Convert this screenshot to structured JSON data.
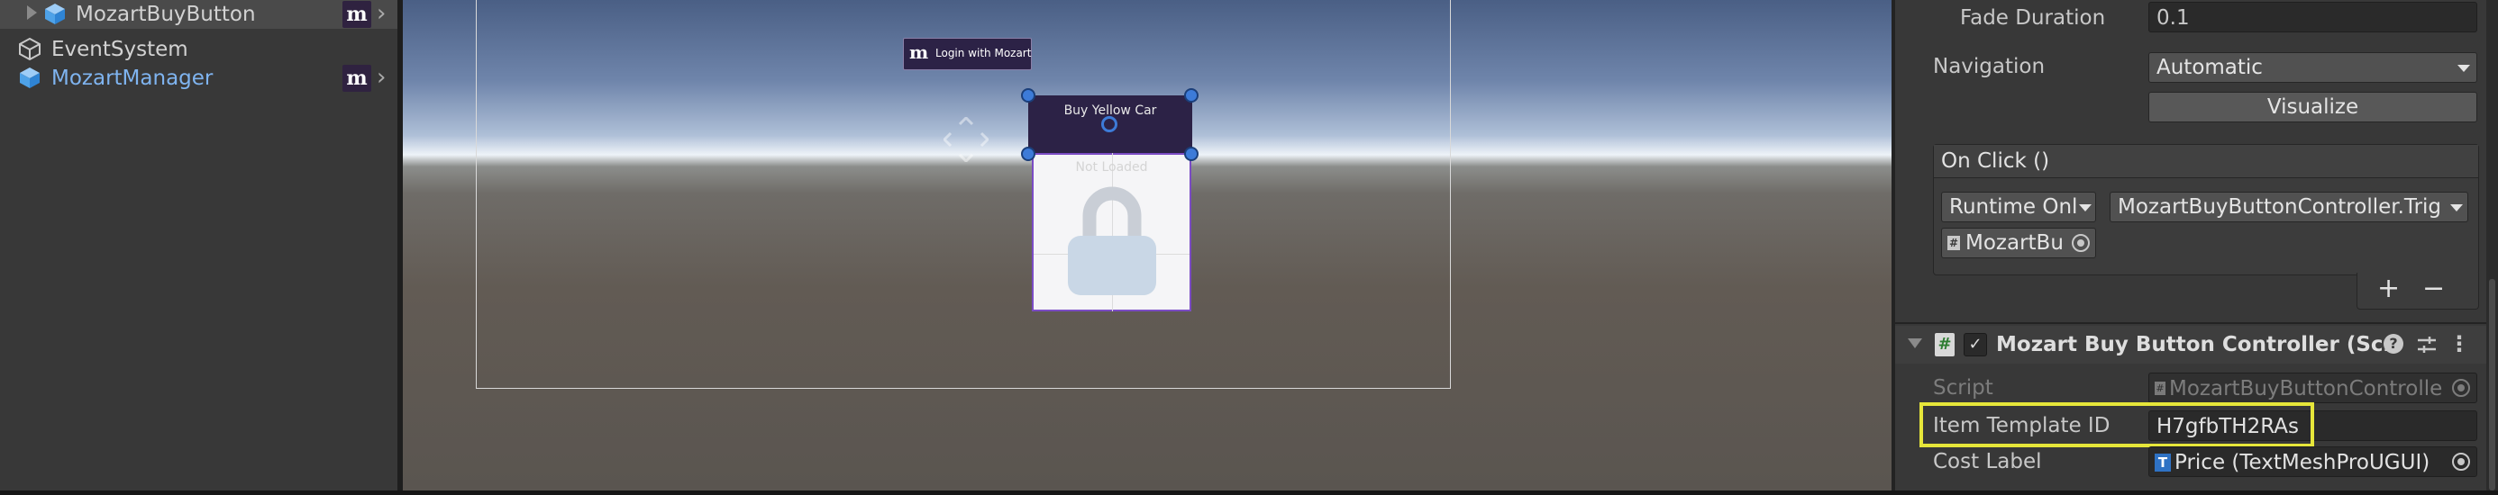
{
  "hierarchy": {
    "items": [
      {
        "label": "MozartBuyButton",
        "icon": "gameobject-cube-icon",
        "badge": "m",
        "selected": true
      },
      {
        "label": "EventSystem",
        "icon": "gameobject-outline-cube-icon"
      },
      {
        "label": "MozartManager",
        "icon": "prefab-cube-icon",
        "badge": "m",
        "color": "#7fb4f0"
      }
    ]
  },
  "scene": {
    "login_button": {
      "logo": "m",
      "label": "Login with Mozart"
    },
    "buy_button": {
      "label": "Buy Yellow Car"
    },
    "item_card": {
      "status": "Not Loaded",
      "icon": "padlock-icon"
    }
  },
  "inspector": {
    "fade_duration": {
      "label": "Fade Duration",
      "value": "0.1"
    },
    "navigation": {
      "label": "Navigation",
      "value": "Automatic"
    },
    "visualize_button": "Visualize",
    "on_click": {
      "header": "On Click ()",
      "runtime_mode": "Runtime Onl",
      "function": "MozartBuyButtonController.Trig",
      "target_object": "MozartBu",
      "add_label": "+",
      "remove_label": "−"
    },
    "component": {
      "title": "Mozart Buy Button Controller (Scri",
      "enabled": true,
      "script_label": "Script",
      "script_value": "MozartBuyButtonControlle",
      "item_template_label": "Item Template ID",
      "item_template_value": "H7gfbTH2RAs",
      "cost_label": "Cost Label",
      "cost_value": "Price (TextMeshProUGUI)",
      "cost_icon_letter": "T"
    },
    "highlight_color": "#e6e63a"
  }
}
